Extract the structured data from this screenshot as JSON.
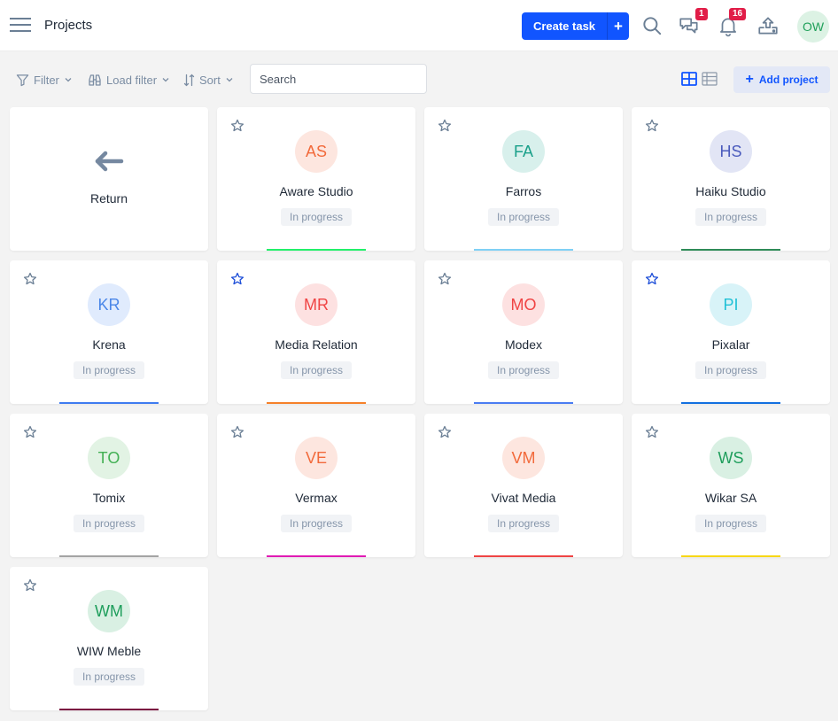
{
  "header": {
    "title": "Projects",
    "create_task_label": "Create task",
    "create_task_plus": "+",
    "messages_badge": "1",
    "notifications_badge": "16",
    "user_initials": "OW"
  },
  "toolbar": {
    "filter_label": "Filter",
    "load_filter_label": "Load filter",
    "sort_label": "Sort",
    "search_placeholder": "Search",
    "search_value": "",
    "add_project_label": "Add project",
    "active_view": "grid"
  },
  "return_card": {
    "label": "Return"
  },
  "projects": [
    {
      "initials": "AS",
      "name": "Aware Studio",
      "status": "In progress",
      "starred": false,
      "avatar_bg": "#fde6df",
      "avatar_fg": "#f26a3b",
      "accent": "#22f06a"
    },
    {
      "initials": "FA",
      "name": "Farros",
      "status": "In progress",
      "starred": false,
      "avatar_bg": "#d8f0ec",
      "avatar_fg": "#1aa08a",
      "accent": "#7fd0f5"
    },
    {
      "initials": "HS",
      "name": "Haiku Studio",
      "status": "In progress",
      "starred": false,
      "avatar_bg": "#e2e5f5",
      "avatar_fg": "#4b5bbd",
      "accent": "#2e8b57"
    },
    {
      "initials": "KR",
      "name": "Krena",
      "status": "In progress",
      "starred": false,
      "avatar_bg": "#e0ebfd",
      "avatar_fg": "#4a86e8",
      "accent": "#3e7bf0"
    },
    {
      "initials": "MR",
      "name": "Media Relation",
      "status": "In progress",
      "starred": true,
      "avatar_bg": "#fde1e1",
      "avatar_fg": "#f04444",
      "accent": "#f5812a"
    },
    {
      "initials": "MO",
      "name": "Modex",
      "status": "In progress",
      "starred": false,
      "avatar_bg": "#fde1e1",
      "avatar_fg": "#f04444",
      "accent": "#4a7cf2"
    },
    {
      "initials": "PI",
      "name": "Pixalar",
      "status": "In progress",
      "starred": true,
      "avatar_bg": "#d8f3f8",
      "avatar_fg": "#1fc0d6",
      "accent": "#1270e0"
    },
    {
      "initials": "TO",
      "name": "Tomix",
      "status": "In progress",
      "starred": false,
      "avatar_bg": "#e2f3e4",
      "avatar_fg": "#43b054",
      "accent": "#a3a3a3"
    },
    {
      "initials": "VE",
      "name": "Vermax",
      "status": "In progress",
      "starred": false,
      "avatar_bg": "#fde6df",
      "avatar_fg": "#f26a3b",
      "accent": "#e01ab4"
    },
    {
      "initials": "VM",
      "name": "Vivat Media",
      "status": "In progress",
      "starred": false,
      "avatar_bg": "#fde6df",
      "avatar_fg": "#f26a3b",
      "accent": "#ef4444"
    },
    {
      "initials": "WS",
      "name": "Wikar SA",
      "status": "In progress",
      "starred": false,
      "avatar_bg": "#d9f0e3",
      "avatar_fg": "#1f9e5c",
      "accent": "#f7d716"
    },
    {
      "initials": "WM",
      "name": "WIW Meble",
      "status": "In progress",
      "starred": false,
      "avatar_bg": "#d9f0e3",
      "avatar_fg": "#1f9e5c",
      "accent": "#7a1040"
    }
  ],
  "colors": {
    "primary": "#1155ff",
    "badge": "#e11d48",
    "star_active": "#1d4ed8",
    "star_inactive": "#6b7f95"
  }
}
